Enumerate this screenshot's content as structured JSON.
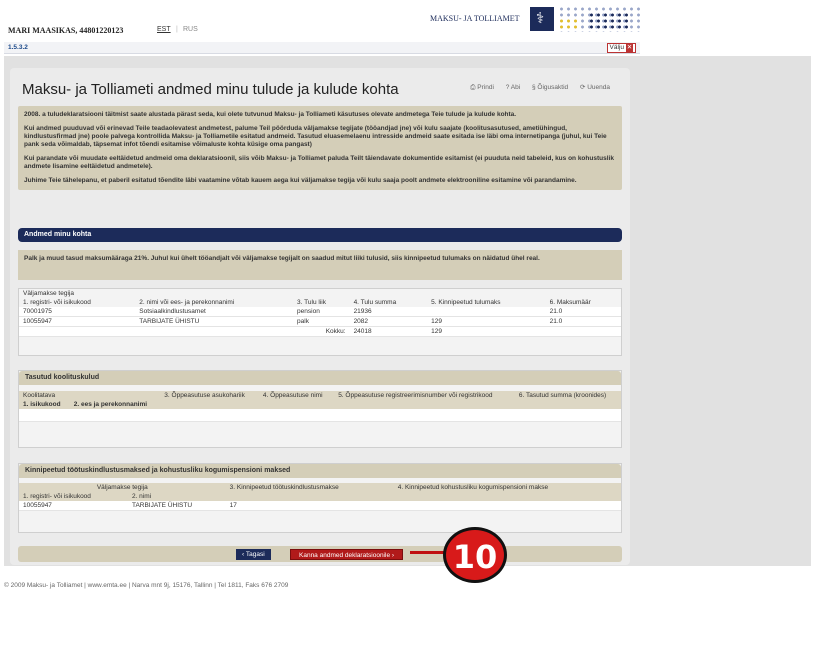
{
  "header": {
    "user": "MARI MAASIKAS, 44801220123",
    "lang_est": "EST",
    "lang_sep": "|",
    "lang_rus": "RUS",
    "brand": "MAKSU- JA TOLLIAMET",
    "logo_glyph": "⚕"
  },
  "crumbbar": {
    "code": "1.5.3.2",
    "exit_label": "Välju",
    "exit_x": "✕"
  },
  "page": {
    "title": "Maksu- ja Tolliameti andmed minu tulude ja kulude kohta",
    "tools": [
      "⎙ Prindi",
      "? Abi",
      "§ Õigusaktid",
      "⟳ Uuenda"
    ],
    "intro": [
      "2008. a tuludeklaratsiooni täitmist saate alustada pärast seda, kui olete tutvunud Maksu- ja Tolliameti käsutuses olevate andmetega Teie tulude ja kulude kohta.",
      "Kui andmed puuduvad või erinevad Teile teadaolevatest andmetest, palume Teil pöörduda väljamakse tegijate (tööandjad jne) või kulu saajate (koolitusasutused, ametiühingud, kindlustusfirmad jne) poole palvega kontrollida Maksu- ja Tolliametile esitatud andmeid. Tasutud eluasemelaenu intresside andmeid saate esitada ise läbi oma internetipanga (juhul, kui Teie pank seda võimaldab, täpsemat infot tõendi esitamise võimaluste kohta küsige oma pangast)",
      "Kui parandate või muudate eeltäidetud andmeid oma deklaratsioonil, siis võib Maksu- ja Tolliamet paluda Teilt täiendavate dokumentide esitamist (ei puuduta neid tabeleid, kus on kohustuslik andmete lisamine eeltäidetud andmetele).",
      "Juhime Teie tähelepanu, et paberil esitatud tõendite läbi vaatamine võtab kauem aega kui väljamakse tegija või kulu saaja poolt andmete elektrooniline esitamine või parandamine."
    ]
  },
  "section": {
    "title": "Andmed minu kohta",
    "note": "Palk ja muud tasud maksumääraga 21%. Juhul kui ühelt tööandjalt või väljamakse tegijalt on saadud mitut liiki tulusid, siis kinnipeetud tulumaks on näidatud ühel real."
  },
  "income": {
    "heading": "Väljamakse tegija",
    "columns": [
      "1. registri- või isikukood",
      "2. nimi või ees- ja perekonnanimi",
      "3. Tulu liik",
      "4. Tulu summa",
      "5. Kinnipeetud tulumaks",
      "6. Maksumäär"
    ],
    "rows": [
      [
        "70001975",
        "Sotsiaalkindlustusamet",
        "pension",
        "21936",
        "",
        "21.0"
      ],
      [
        "10055947",
        "TARBIJATE ÜHISTU",
        "palk",
        "2082",
        "129",
        "21.0"
      ]
    ],
    "total_label": "Kokku:",
    "total_sum": "24018",
    "total_tax": "129"
  },
  "training": {
    "title": "Tasutud koolituskulud",
    "col_group": "Koolitatava",
    "col_id": "1. isikukood",
    "col_name": "2. ees ja perekonnanimi",
    "col3": "3. Õppeasutuse asukohariik",
    "col4": "4. Õppeasutuse nimi",
    "col5": "5. Õppeasutuse registreerimisnumber või registrikood",
    "col6": "6. Tasutud summa (kroonides)"
  },
  "pension": {
    "title": "Kinnipeetud töötuskindlustusmaksed ja kohustusliku kogumispensioni maksed",
    "col_group": "Väljamakse tegija",
    "col3": "3. Kinnipeetud töötuskindlustusmakse",
    "col4": "4. Kinnipeetud kohustusliku kogumispensioni makse",
    "col1": "1. registri- või isikukood",
    "col2": "2. nimi",
    "row": [
      "10055947",
      "TARBIJATE ÜHISTU",
      "17",
      ""
    ]
  },
  "buttons": {
    "back": "‹ Tagasi",
    "next": "Kanna andmed deklaratsioonile ›"
  },
  "callout": "10",
  "footer": "© 2009 Maksu- ja Tolliamet   |   www.emta.ee   |   Narva mnt 9j, 15176, Tallinn   |   Tel 1811, Faks 676 2709"
}
